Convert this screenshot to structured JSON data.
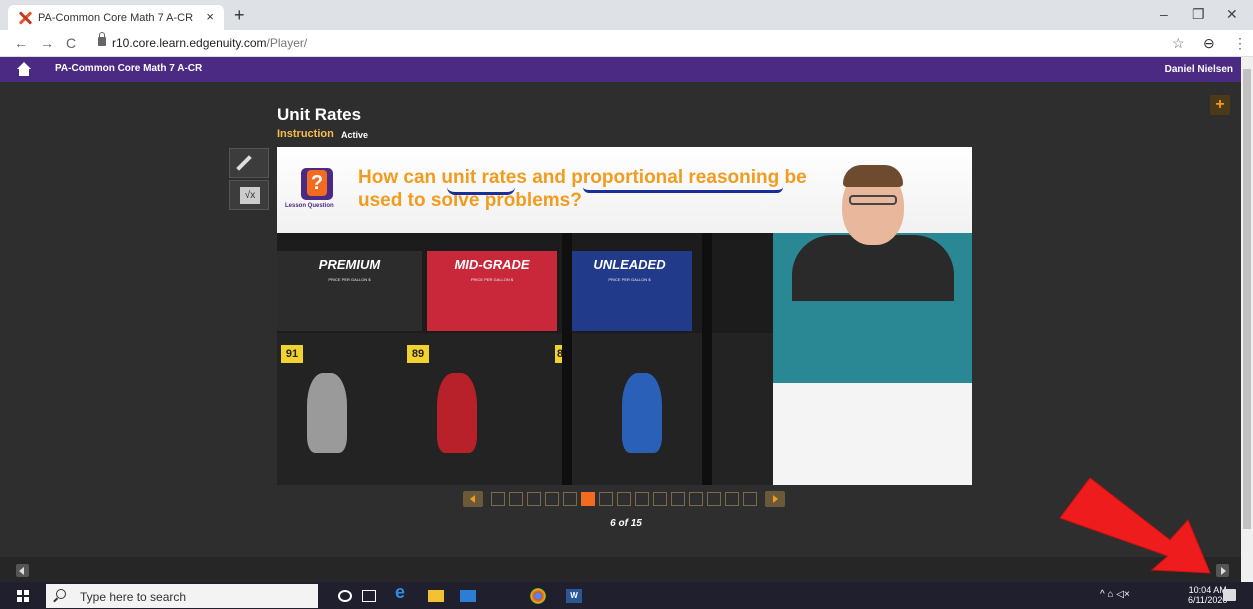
{
  "browser": {
    "tab_title": "PA-Common Core Math 7 A-CR",
    "tab_close": "×",
    "new_tab": "+",
    "url_host": "r10.core.learn.edgenuity.com",
    "url_path": "/Player/",
    "win_min": "–",
    "win_max": "❐",
    "win_close": "✕",
    "back": "←",
    "forward": "→",
    "reload": "C",
    "star": "☆",
    "profile": "⊖",
    "menu": "⋮"
  },
  "app": {
    "course_title": "PA-Common Core Math 7 A-CR",
    "user_name": "Daniel Nielsen"
  },
  "lesson": {
    "unit_title": "Unit Rates",
    "activity_type": "Instruction",
    "activity_status": "Active",
    "plus_label": "+",
    "calc_label": "√x",
    "lesson_question_label": "Lesson Question",
    "question_line1": "How can unit rates and proportional reasoning be",
    "question_line2": "used to solve problems?",
    "pump_labels": [
      "PREMIUM",
      "MID-GRADE",
      "UNLEADED"
    ],
    "price_per_gallon": "PRICE PER GALLON $",
    "octanes": [
      "91",
      "89",
      "8"
    ],
    "current_page": 6,
    "total_pages": 15,
    "page_count_text": "6 of 15"
  },
  "taskbar": {
    "search_placeholder": "Type here to search",
    "time": "10:04 AM",
    "date": "6/11/2020",
    "tray": "^  ⌂  ◁×"
  }
}
